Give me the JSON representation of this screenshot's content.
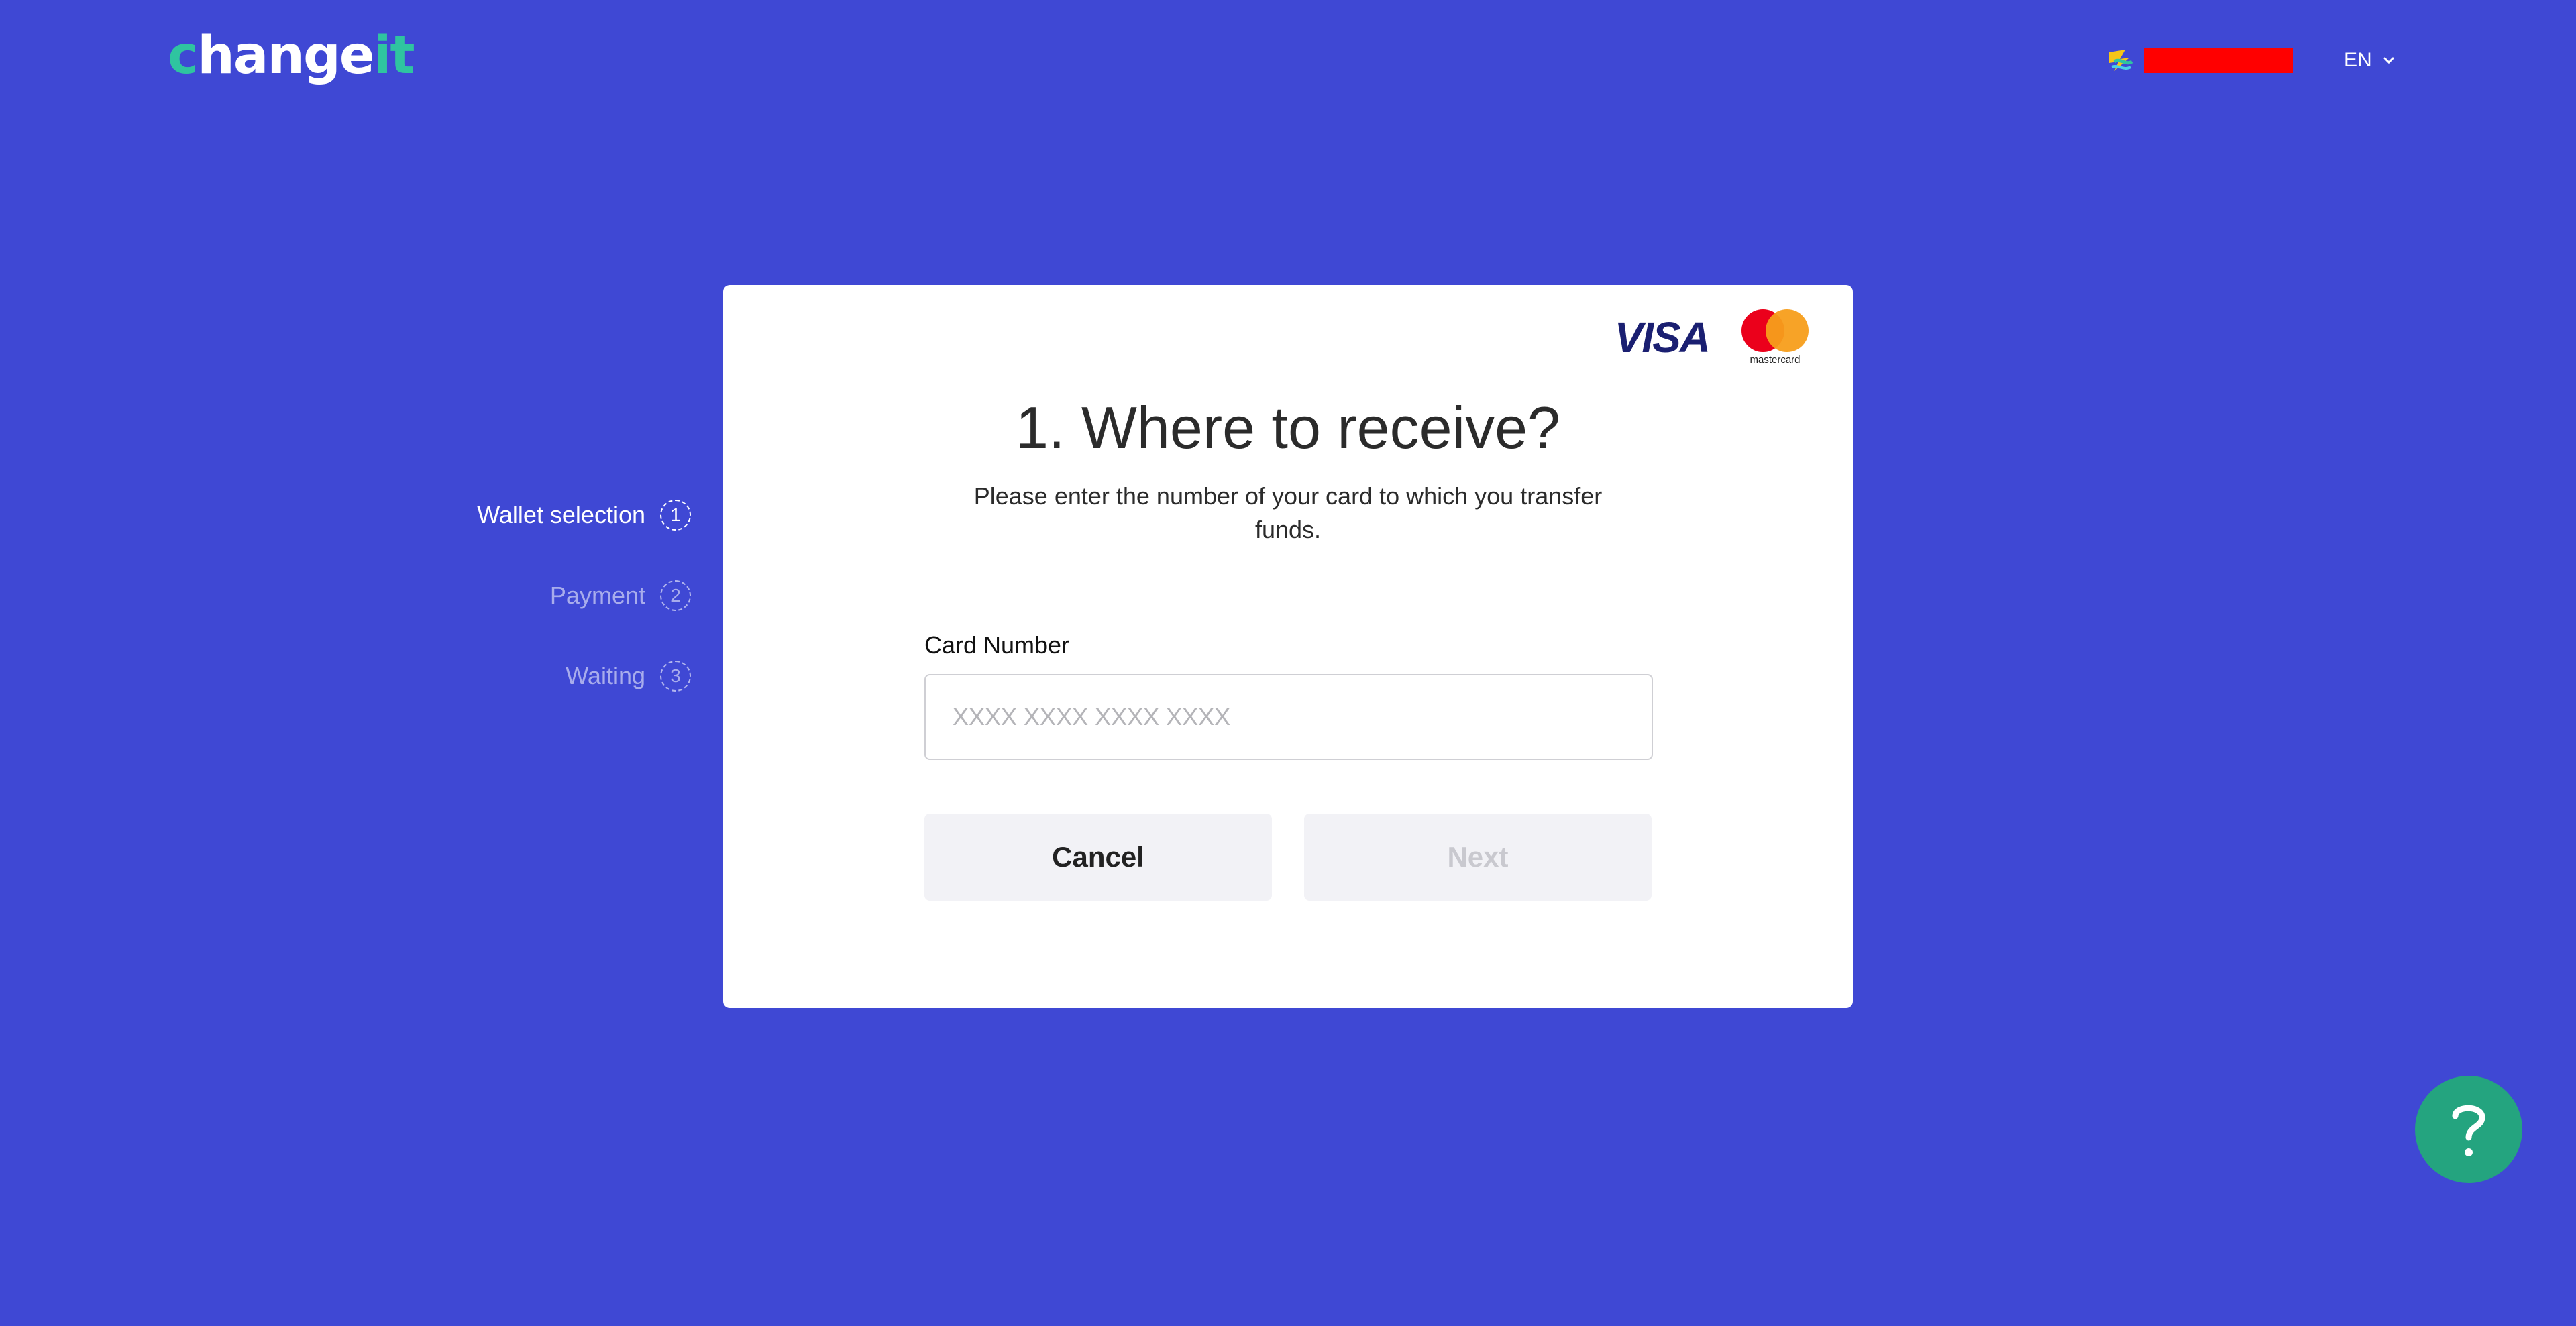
{
  "header": {
    "logo": {
      "part1": "c",
      "part2": "hange",
      "part3": "it"
    },
    "language": {
      "selected": "EN"
    },
    "icons": {
      "brand": "brand-icon",
      "chevron": "chevron-down-icon"
    }
  },
  "steps": [
    {
      "label": "Wallet selection",
      "number": "1",
      "active": true
    },
    {
      "label": "Payment",
      "number": "2",
      "active": false
    },
    {
      "label": "Waiting",
      "number": "3",
      "active": false
    }
  ],
  "card": {
    "payment_logos": {
      "visa": "VISA",
      "mastercard": "mastercard"
    },
    "title": "1. Where to receive?",
    "subtitle": "Please enter the number of your card to which you transfer funds.",
    "field_label": "Card Number",
    "card_input": {
      "value": "",
      "placeholder": "XXXX XXXX XXXX XXXX"
    },
    "cancel_label": "Cancel",
    "next_label": "Next"
  },
  "help": {
    "icon": "question-mark-icon"
  },
  "colors": {
    "background": "#3f48d4",
    "accent": "#2fc4a0",
    "help_button": "#24a47f",
    "redacted": "#ff0000"
  }
}
